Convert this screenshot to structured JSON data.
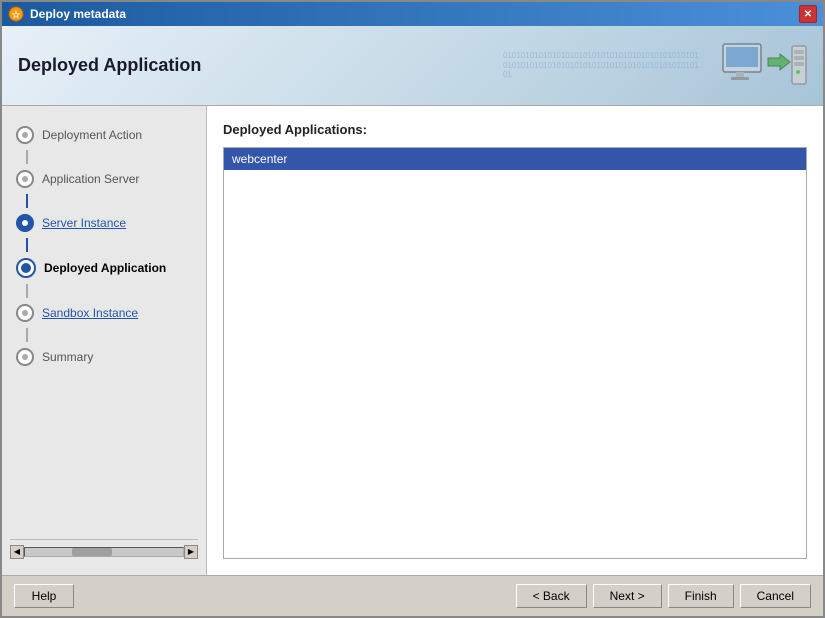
{
  "window": {
    "title": "Deploy metadata",
    "close_label": "✕"
  },
  "header": {
    "title": "Deployed Application",
    "bg_text": "010101010101010101011010101010111011010101010101..."
  },
  "sidebar": {
    "items": [
      {
        "id": "deployment-action",
        "label": "Deployment Action",
        "state": "inactive"
      },
      {
        "id": "application-server",
        "label": "Application Server",
        "state": "inactive"
      },
      {
        "id": "server-instance",
        "label": "Server Instance",
        "state": "link"
      },
      {
        "id": "deployed-application",
        "label": "Deployed Application",
        "state": "current"
      },
      {
        "id": "sandbox-instance",
        "label": "Sandbox Instance",
        "state": "link"
      },
      {
        "id": "summary",
        "label": "Summary",
        "state": "inactive"
      }
    ]
  },
  "content": {
    "label": "Deployed Applications:",
    "items": [
      {
        "id": "webcenter",
        "label": "webcenter",
        "selected": true
      }
    ]
  },
  "footer": {
    "help_label": "Help",
    "back_label": "< Back",
    "next_label": "Next >",
    "finish_label": "Finish",
    "cancel_label": "Cancel"
  }
}
